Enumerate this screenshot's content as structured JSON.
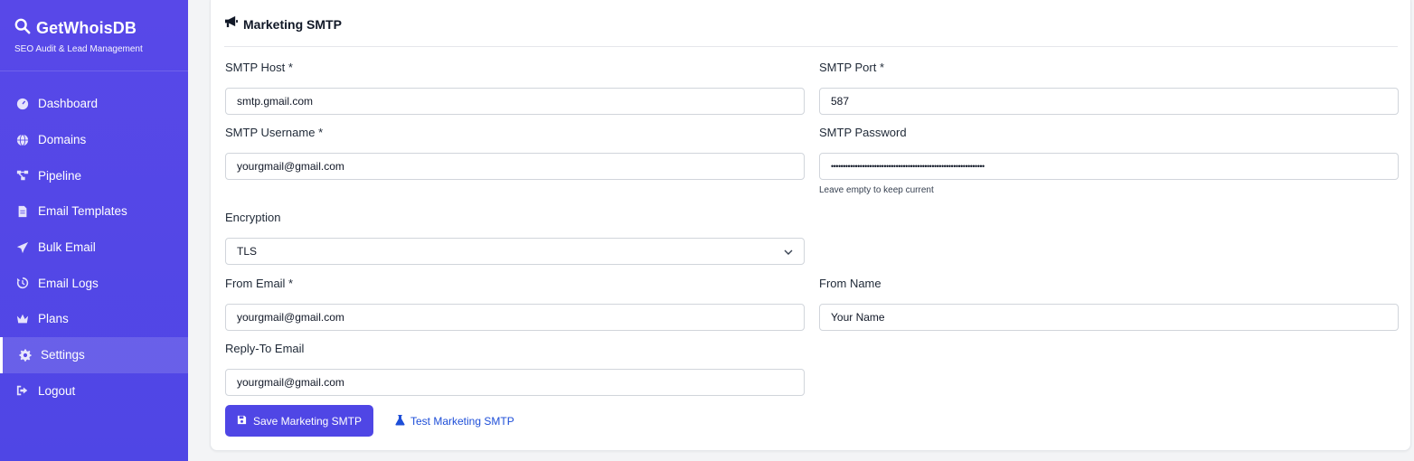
{
  "brand": {
    "name": "GetWhoisDB",
    "tagline": "SEO Audit & Lead Management"
  },
  "nav": [
    {
      "label": "Dashboard",
      "icon": "gauge-icon"
    },
    {
      "label": "Domains",
      "icon": "globe-icon"
    },
    {
      "label": "Pipeline",
      "icon": "pipeline-icon"
    },
    {
      "label": "Email Templates",
      "icon": "file-icon"
    },
    {
      "label": "Bulk Email",
      "icon": "paper-plane-icon"
    },
    {
      "label": "Email Logs",
      "icon": "history-icon"
    },
    {
      "label": "Plans",
      "icon": "crown-icon"
    },
    {
      "label": "Settings",
      "icon": "gear-icon",
      "active": true
    },
    {
      "label": "Logout",
      "icon": "logout-icon"
    }
  ],
  "card": {
    "title": "Marketing SMTP"
  },
  "form": {
    "smtp_host": {
      "label": "SMTP Host *",
      "value": "smtp.gmail.com"
    },
    "smtp_port": {
      "label": "SMTP Port *",
      "value": "587"
    },
    "smtp_username": {
      "label": "SMTP Username *",
      "value": "yourgmail@gmail.com"
    },
    "smtp_password": {
      "label": "SMTP Password",
      "value": "••••••••••••••••••••••••••••••••••••••••••••••••••••••••••••••••",
      "hint": "Leave empty to keep current"
    },
    "encryption": {
      "label": "Encryption",
      "value": "TLS"
    },
    "from_email": {
      "label": "From Email *",
      "value": "yourgmail@gmail.com"
    },
    "from_name": {
      "label": "From Name",
      "value": "Your Name"
    },
    "reply_to": {
      "label": "Reply-To Email",
      "value": "yourgmail@gmail.com"
    }
  },
  "actions": {
    "save": "Save Marketing SMTP",
    "test": "Test Marketing SMTP"
  },
  "colors": {
    "accent": "#4f46e5",
    "link": "#1d4ed8"
  }
}
